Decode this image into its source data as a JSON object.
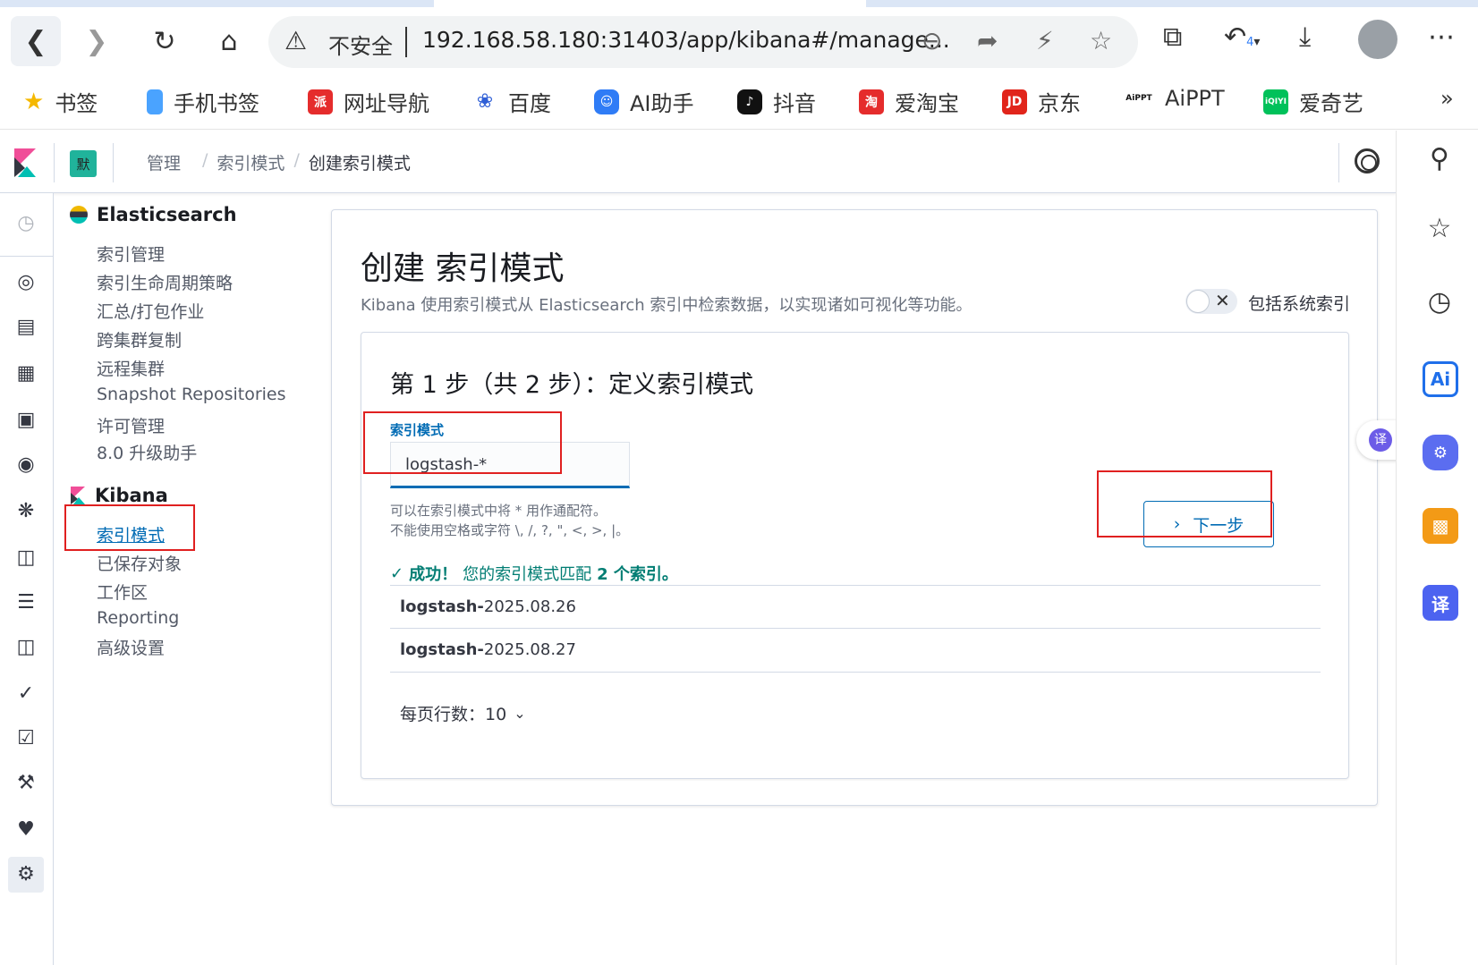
{
  "browser": {
    "address": {
      "security_label": "不安全",
      "url": "192.168.58.180:31403/app/kibana#/manage..."
    },
    "bookmarks": [
      {
        "label": "书签",
        "icon": "star-icon",
        "color": "#f5b800"
      },
      {
        "label": "手机书签",
        "icon": "phone-bookmark-icon",
        "color": "#4aa3ff"
      },
      {
        "label": "网址导航",
        "icon": "nav-icon",
        "color": "#e52c2c"
      },
      {
        "label": "百度",
        "icon": "baidu-icon",
        "color": "#2f5fd6"
      },
      {
        "label": "AI助手",
        "icon": "ai-assistant-icon",
        "color": "#2f7cf6"
      },
      {
        "label": "抖音",
        "icon": "douyin-icon",
        "color": "#111111"
      },
      {
        "label": "爱淘宝",
        "icon": "taobao-icon",
        "color": "#e52c2c"
      },
      {
        "label": "京东",
        "icon": "jd-icon",
        "color": "#e1251b"
      },
      {
        "label": "AiPPT",
        "icon": "aippt-icon",
        "color": "#111111"
      },
      {
        "label": "爱奇艺",
        "icon": "iqiyi-icon",
        "color": "#00c15a"
      }
    ],
    "bookmarks_overflow": "»",
    "history_count": "4"
  },
  "kibana": {
    "space_badge": "默",
    "breadcrumbs": {
      "root": "管理",
      "mid": "索引模式",
      "current": "创建索引模式"
    },
    "side_nav": {
      "elasticsearch": {
        "title": "Elasticsearch",
        "items": [
          "索引管理",
          "索引生命周期策略",
          "汇总/打包作业",
          "跨集群复制",
          "远程集群",
          "Snapshot Repositories",
          "许可管理",
          "8.0 升级助手"
        ]
      },
      "kibana": {
        "title": "Kibana",
        "items": [
          "索引模式",
          "已保存对象",
          "工作区",
          "Reporting",
          "高级设置"
        ],
        "selected": "索引模式"
      }
    },
    "page": {
      "title": "创建 索引模式",
      "description": "Kibana 使用索引模式从 Elasticsearch 索引中检索数据，以实现诸如可视化等功能。",
      "system_indices_label": "包括系统索引",
      "step_title": "第 1 步（共 2 步）：定义索引模式",
      "field_label": "索引模式",
      "pattern_value": "logstash-*",
      "help_line1": "可以在索引模式中将 * 用作通配符。",
      "help_line2": "不能使用空格或字符 \\, /, ?, \", <, >, |。",
      "success_prefix": "成功！",
      "success_text": "您的索引模式匹配",
      "success_count": "2 个索引。",
      "indices": [
        {
          "prefix": "logstash-",
          "suffix": "2025.08.26"
        },
        {
          "prefix": "logstash-",
          "suffix": "2025.08.27"
        }
      ],
      "rows_per_page_label": "每页行数：10",
      "next_button": "下一步"
    }
  },
  "right_sidebar": {
    "translate_bubble": "译",
    "ai_label": "Ai",
    "translate_label": "译"
  },
  "colors": {
    "accent": "#006bb4",
    "success": "#017d73",
    "annotation_red": "#e02020"
  }
}
